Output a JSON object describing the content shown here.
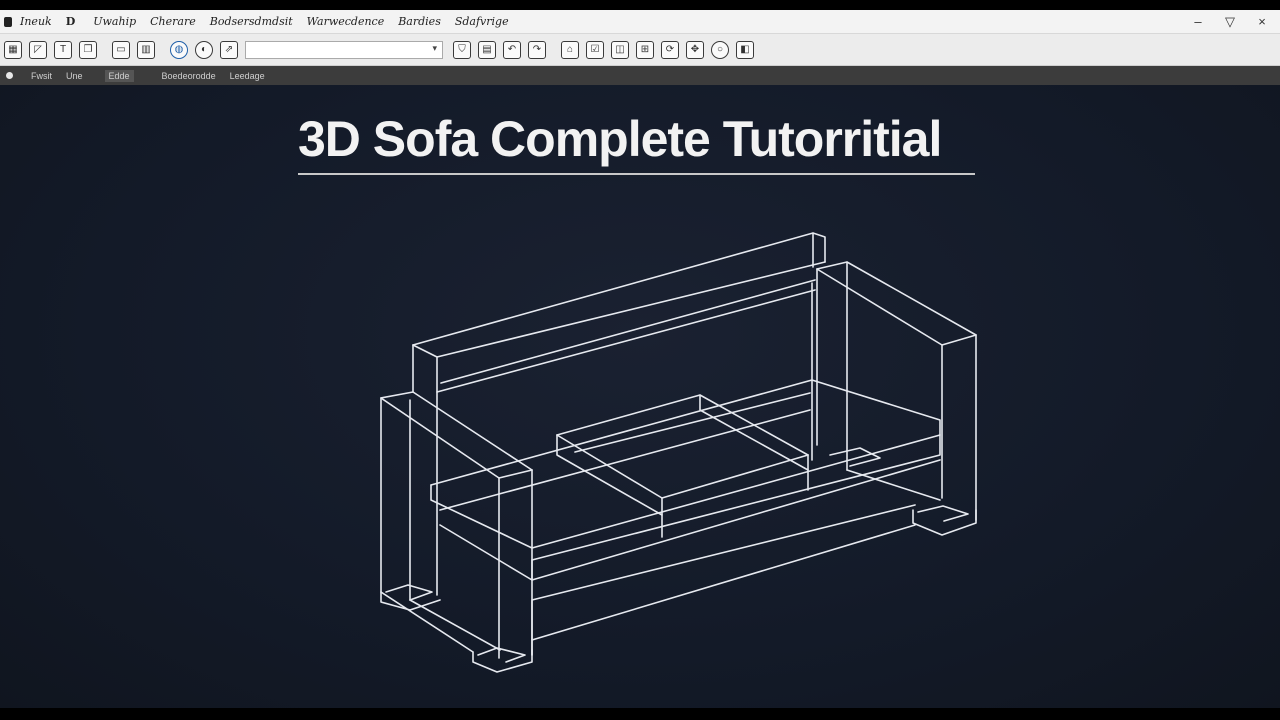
{
  "window": {
    "menu": [
      "Ineuk",
      "D",
      "Uwahip",
      "Cherare",
      "Bodsersdmdsit",
      "Warwecdence",
      "Bardies",
      "Sdafvrige"
    ],
    "controls": [
      "–",
      "▽",
      "×"
    ]
  },
  "toolbar": {
    "combo_value": "",
    "combo_caret": "▾",
    "left_icons": [
      "new-file-icon",
      "open-icon",
      "text-icon",
      "copy-icon",
      "window-icon",
      "panel-icon",
      "globe-icon",
      "sphere-icon",
      "export-icon"
    ],
    "right_icons": [
      "shield-icon",
      "folder-icon",
      "undo-icon",
      "redo-icon",
      "home-icon",
      "checklist-icon",
      "layers-icon",
      "grid-icon",
      "rotate-icon",
      "move-icon",
      "circle-icon",
      "frame-icon"
    ]
  },
  "statusbar": {
    "items": [
      "Fwsit",
      "Une",
      "Edde",
      "Boedeorodde",
      "Leedage"
    ]
  },
  "viewport": {
    "title": "3D Sofa Complete Tutorritial"
  }
}
